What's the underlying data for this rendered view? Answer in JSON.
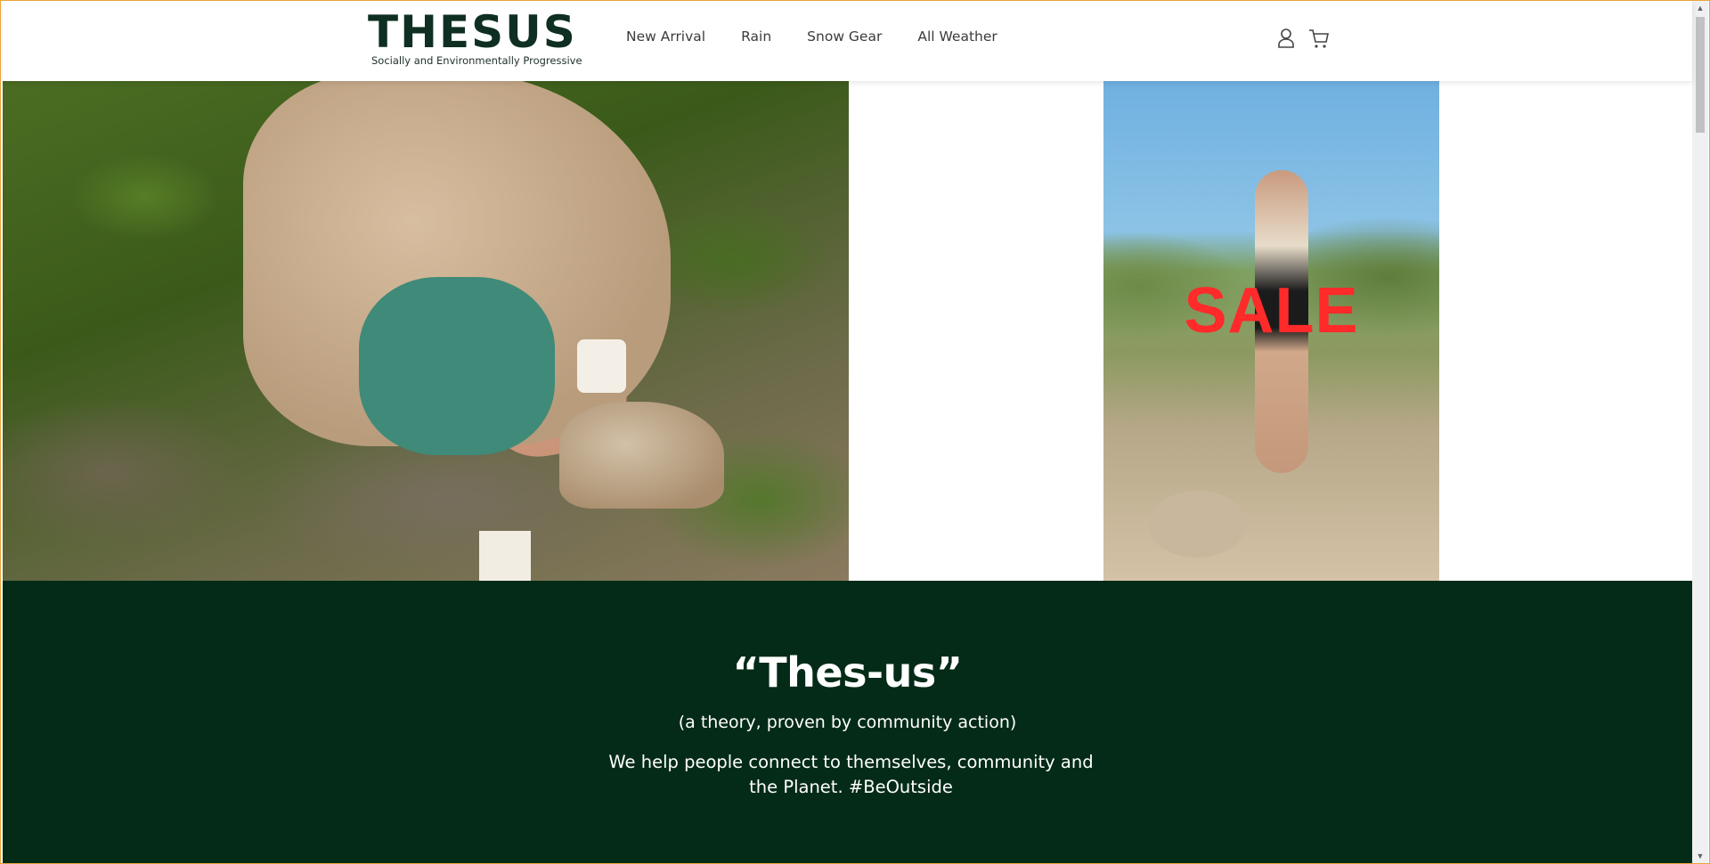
{
  "header": {
    "logo_word": "THESUS",
    "logo_tagline": "Socially and Environmentally Progressive",
    "nav": [
      "New Arrival",
      "Rain",
      "Snow Gear",
      "All Weather"
    ],
    "icons": [
      "user-icon",
      "cart-icon"
    ]
  },
  "promo": {
    "sale_label": "SALE"
  },
  "about": {
    "title": "“Thes-us”",
    "subtitle": "(a theory, proven by community action)",
    "description": "We help people connect to themselves, community and the Planet. #BeOutside"
  },
  "colors": {
    "accent_dark_green": "#042b17",
    "sale_red": "#ff2a2a",
    "border_orange": "#e9a43c"
  }
}
